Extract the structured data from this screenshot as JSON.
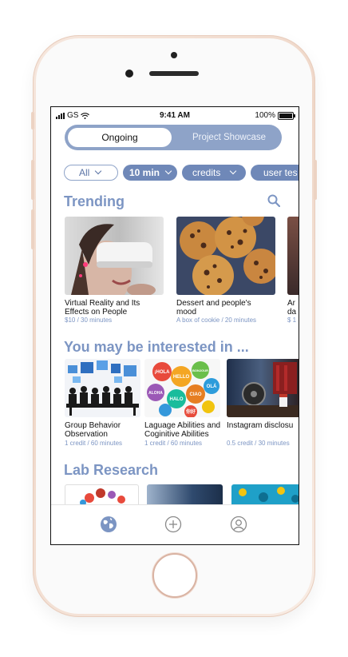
{
  "status_bar": {
    "carrier": "GS",
    "time": "9:41 AM",
    "battery": "100%"
  },
  "segmented": {
    "active": "Ongoing",
    "inactive": "Project Showcase"
  },
  "filters": [
    {
      "label": "All",
      "style": "outline"
    },
    {
      "label": "10 min",
      "style": "fill"
    },
    {
      "label": "credits",
      "style": "fill"
    },
    {
      "label": "user tes",
      "style": "fill"
    }
  ],
  "sections": {
    "trending": "Trending",
    "interested": "You may be interested in ...",
    "lab": "Lab Research"
  },
  "trending_cards": [
    {
      "title": "Virtual Reality and Its\nEffects on People",
      "sub": "$10 / 30 minutes"
    },
    {
      "title": "Dessert and people's\nmood",
      "sub": "A box of cookie / 20 minutes"
    },
    {
      "title": "Ar\nda",
      "sub": "$ 1"
    }
  ],
  "interest_cards": [
    {
      "title": "Group Behavior\nObservation",
      "sub": "1 credit / 60 minutes"
    },
    {
      "title": "Laguage Abilities and\nCoginitive Abilities",
      "sub": "1 credit / 60 minutes"
    },
    {
      "title": "Instagram disclosu",
      "sub": "0.5 credit / 30 minutes"
    }
  ],
  "hello_words": [
    "¡HOLA",
    "HELLO",
    "OLÁ",
    "CIAO",
    "HALO",
    "你好",
    "ALOHA",
    "BONJOUR"
  ],
  "colors": {
    "accent": "#7c95c3",
    "chip": "#6f88b8",
    "segment": "#8ea3c8"
  }
}
